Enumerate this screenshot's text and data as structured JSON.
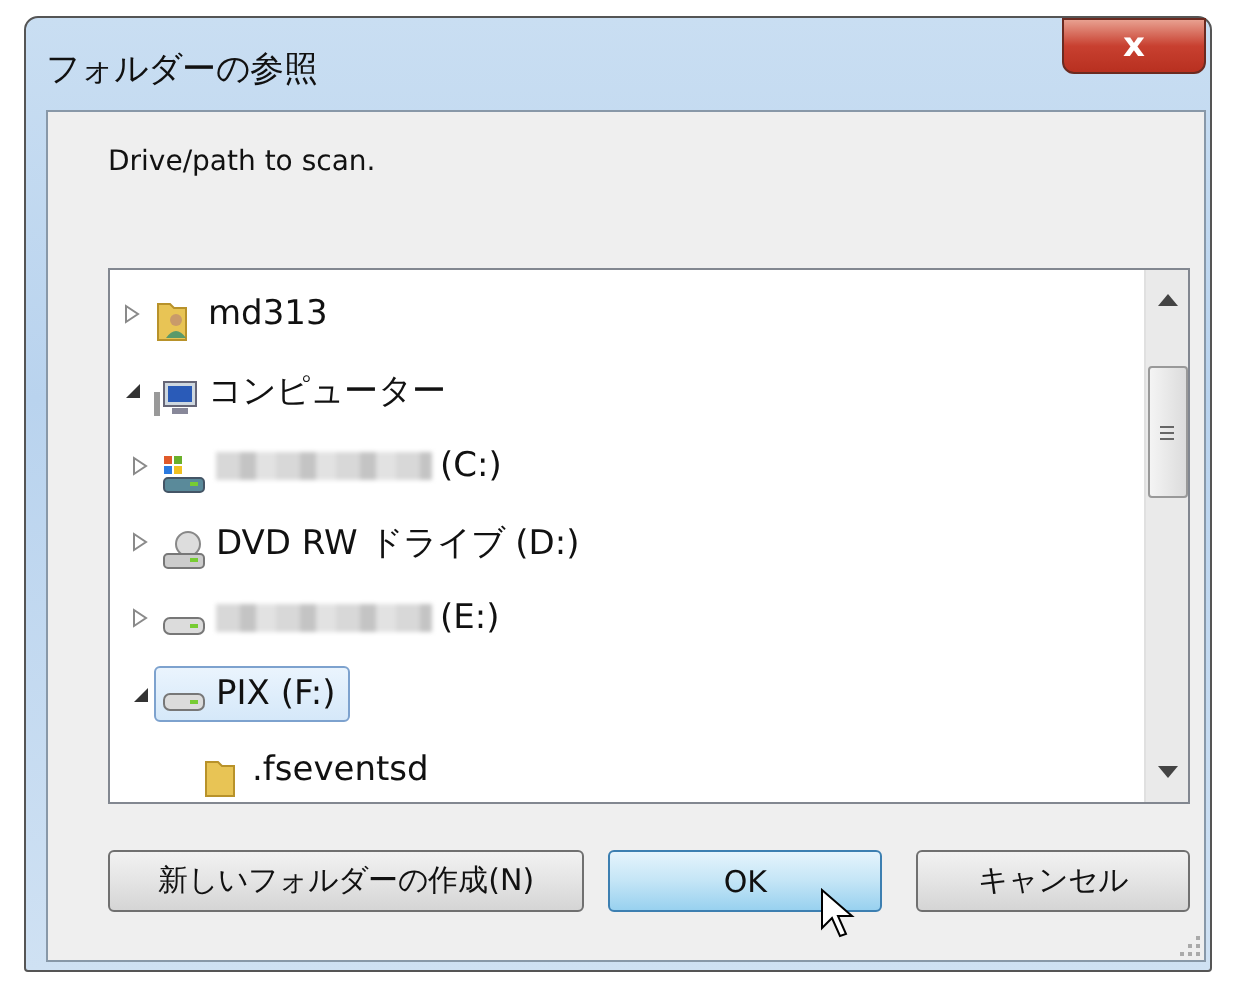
{
  "window": {
    "title": "フォルダーの参照"
  },
  "close_button": {
    "label": "x"
  },
  "prompt": "Drive/path to scan.",
  "tree": [
    {
      "label": "md313",
      "kind": "user-folder",
      "expanded": false,
      "selected": false
    },
    {
      "label": "コンピューター",
      "kind": "computer",
      "expanded": true,
      "selected": false,
      "children": [
        {
          "label": "(C:)",
          "kind": "system-drive",
          "redacted": true,
          "expanded": false,
          "selected": false
        },
        {
          "label": "DVD RW ドライブ (D:)",
          "kind": "dvd-drive",
          "expanded": false,
          "selected": false
        },
        {
          "label": "(E:)",
          "kind": "drive",
          "redacted": true,
          "expanded": false,
          "selected": false
        },
        {
          "label": "PIX (F:)",
          "kind": "drive",
          "expanded": true,
          "selected": true,
          "children": [
            {
              "label": ".fseventsd",
              "kind": "folder",
              "selected": false
            }
          ]
        }
      ]
    }
  ],
  "buttons": [
    {
      "label": "新しいフォルダーの作成(N)",
      "default": false
    },
    {
      "label": "OK",
      "default": true
    },
    {
      "label": "キャンセル",
      "default": false
    }
  ]
}
